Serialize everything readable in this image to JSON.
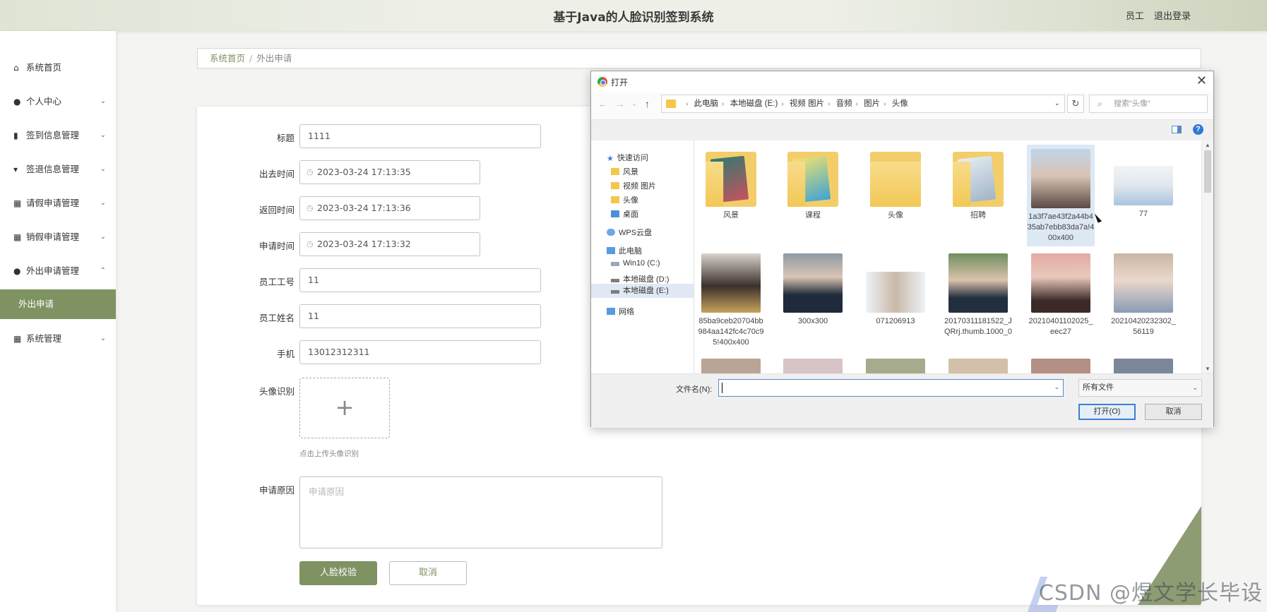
{
  "header": {
    "title": "基于Java的人脸识别签到系统",
    "role": "员工",
    "logout": "退出登录"
  },
  "sidebar": {
    "items": [
      {
        "label": "系统首页",
        "icon": "home-icon"
      },
      {
        "label": "个人中心",
        "icon": "user-icon"
      },
      {
        "label": "签到信息管理",
        "icon": "clipboard-icon"
      },
      {
        "label": "签退信息管理",
        "icon": "pin-icon"
      },
      {
        "label": "请假申请管理",
        "icon": "grid-icon"
      },
      {
        "label": "销假申请管理",
        "icon": "grid-icon"
      },
      {
        "label": "外出申请管理",
        "icon": "bulb-icon"
      },
      {
        "label": "系统管理",
        "icon": "grid-icon"
      }
    ],
    "active_sub": "外出申请"
  },
  "breadcrumb": {
    "home": "系统首页",
    "sep": "/",
    "current": "外出申请"
  },
  "form": {
    "title_label": "标题",
    "title_value": "1111",
    "out_time_label": "出去时间",
    "out_time_value": "2023-03-24 17:13:35",
    "return_time_label": "返回时间",
    "return_time_value": "2023-03-24 17:13:36",
    "apply_time_label": "申请时间",
    "apply_time_value": "2023-03-24 17:13:32",
    "emp_no_label": "员工工号",
    "emp_no_value": "11",
    "emp_name_label": "员工姓名",
    "emp_name_value": "11",
    "phone_label": "手机",
    "phone_value": "13012312311",
    "avatar_label": "头像识别",
    "upload_hint": "点击上传头像识别",
    "reason_label": "申请原因",
    "reason_placeholder": "申请原因",
    "submit": "人脸校验",
    "cancel": "取消"
  },
  "dialog": {
    "title": "打开",
    "path": [
      "此电脑",
      "本地磁盘 (E:)",
      "视频 图片",
      "音频",
      "图片",
      "头像"
    ],
    "search_placeholder": "搜索\"头像\"",
    "nav": {
      "quick": "快速访问",
      "quick_items": [
        "风景",
        "视频 图片",
        "头像",
        "桌面"
      ],
      "wps": "WPS云盘",
      "pc": "此电脑",
      "drives": [
        "Win10 (C:)",
        "本地磁盘 (D:)",
        "本地磁盘 (E:)"
      ],
      "network": "网络"
    },
    "files_row1": [
      "风景",
      "课程",
      "头像",
      "招聘",
      "1a3f7ae43f2a44b435ab7ebb83da7a!400x400",
      "77"
    ],
    "files_row2": [
      "85ba9ceb20704bb984aa142fc4c70c95!400x400",
      "300x300",
      "071206913",
      "20170311181522_JQRrj.thumb.1000_0",
      "20210401102025_eec27",
      "20210420232302_56119"
    ],
    "filename_label": "文件名(N):",
    "filetype": "所有文件",
    "open_btn": "打开(O)",
    "cancel_btn": "取消"
  },
  "watermark": "CSDN @煜文学长毕设"
}
